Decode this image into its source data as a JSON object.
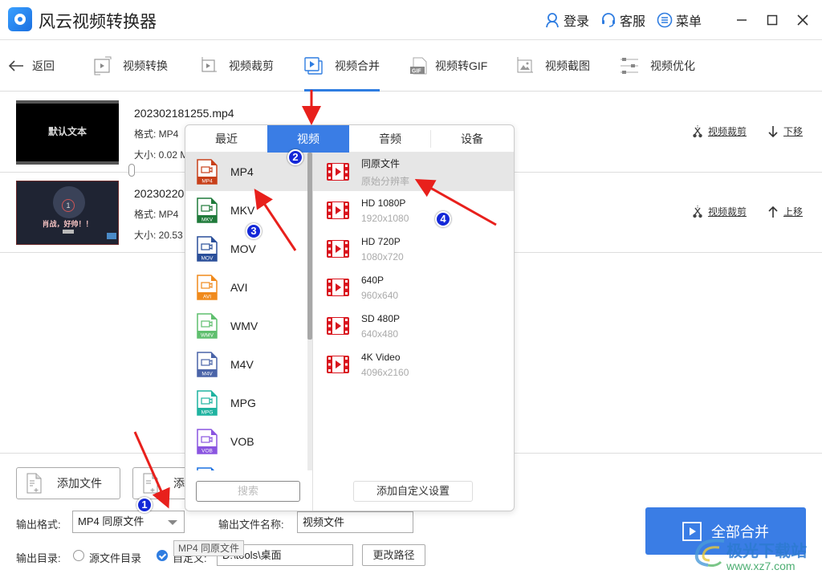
{
  "app": {
    "title": "风云视频转换器",
    "login": "登录",
    "service": "客服",
    "menu": "菜单"
  },
  "toolbar": {
    "back": "返回",
    "tools": [
      {
        "label": "视频转换",
        "icon": "video-convert-icon"
      },
      {
        "label": "视频裁剪",
        "icon": "video-crop-icon"
      },
      {
        "label": "视频合并",
        "icon": "video-merge-icon",
        "active": true
      },
      {
        "label": "视频转GIF",
        "icon": "gif-icon"
      },
      {
        "label": "视频截图",
        "icon": "screenshot-icon"
      },
      {
        "label": "视频优化",
        "icon": "optimize-icon"
      }
    ]
  },
  "files": [
    {
      "name": "202302181255.mp4",
      "format": "格式: MP4",
      "size": "大小: 0.02 M",
      "thumb_text": "默认文本",
      "crop": "视频裁剪",
      "move": "下移"
    },
    {
      "name": "20230220",
      "format": "格式: MP4",
      "size": "大小: 20.53",
      "thumb_text": "肖战，好帅！！",
      "thumb_badge": "1",
      "crop": "视频裁剪",
      "move": "上移"
    }
  ],
  "bottom": {
    "add_file": "添加文件",
    "add_folder_partial": "添",
    "output_format_label": "输出格式:",
    "output_format_value": "MP4 同原文件",
    "output_name_label": "输出文件名称:",
    "output_name_value": "视频文件",
    "output_dir_label": "输出目录:",
    "dir_source": "源文件目录",
    "dir_custom": "自定义:",
    "dir_path": "D:\\tools\\桌面",
    "change_path": "更改路径",
    "tooltip": "MP4 同原文件",
    "merge_all": "全部合并"
  },
  "popup": {
    "tabs": [
      "最近",
      "视频",
      "音频",
      "设备"
    ],
    "active_tab": 1,
    "formats": [
      {
        "label": "MP4",
        "color": "#c8401a",
        "active": true
      },
      {
        "label": "MKV",
        "color": "#1f7a3a"
      },
      {
        "label": "MOV",
        "color": "#2a4f9a"
      },
      {
        "label": "AVI",
        "color": "#f08a1c"
      },
      {
        "label": "WMV",
        "color": "#5fbf6e"
      },
      {
        "label": "M4V",
        "color": "#4a64a8"
      },
      {
        "label": "MPG",
        "color": "#1fb3a0"
      },
      {
        "label": "VOB",
        "color": "#8a55e0"
      }
    ],
    "presets": [
      {
        "name": "同原文件",
        "sub": "原始分辨率",
        "active": true
      },
      {
        "name": "HD 1080P",
        "sub": "1920x1080"
      },
      {
        "name": "HD 720P",
        "sub": "1080x720"
      },
      {
        "name": "640P",
        "sub": "960x640"
      },
      {
        "name": "SD 480P",
        "sub": "640x480"
      },
      {
        "name": "4K Video",
        "sub": "4096x2160"
      }
    ],
    "search_placeholder": "搜索",
    "add_custom": "添加自定义设置",
    "scroll_position": 0
  },
  "annotations": [
    "1",
    "2",
    "3",
    "4"
  ],
  "watermark": {
    "text": "极光下载站",
    "url": "www.xz7.com"
  },
  "colors": {
    "accent": "#3a7de5",
    "preset_icon": "#d9141e",
    "arrow": "#e8201c",
    "badge": "#1428d8"
  }
}
